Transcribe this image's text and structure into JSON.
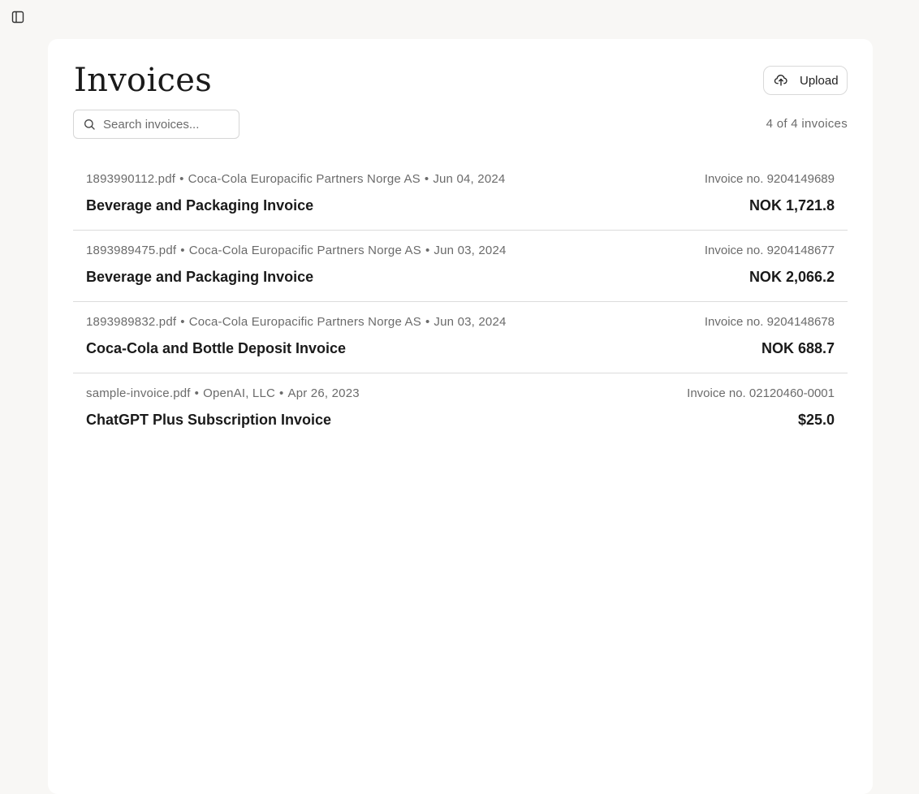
{
  "page": {
    "title": "Invoices",
    "upload_label": "Upload",
    "search_placeholder": "Search invoices...",
    "count_text": "4 of 4 invoices"
  },
  "invoices": [
    {
      "file": "1893990112.pdf",
      "vendor": "Coca-Cola Europacific Partners Norge AS",
      "date": "Jun 04, 2024",
      "invoice_no": "Invoice no. 9204149689",
      "title": "Beverage and Packaging Invoice",
      "amount": "NOK 1,721.8"
    },
    {
      "file": "1893989475.pdf",
      "vendor": "Coca-Cola Europacific Partners Norge AS",
      "date": "Jun 03, 2024",
      "invoice_no": "Invoice no. 9204148677",
      "title": "Beverage and Packaging Invoice",
      "amount": "NOK 2,066.2"
    },
    {
      "file": "1893989832.pdf",
      "vendor": "Coca-Cola Europacific Partners Norge AS",
      "date": "Jun 03, 2024",
      "invoice_no": "Invoice no. 9204148678",
      "title": "Coca-Cola and Bottle Deposit Invoice",
      "amount": "NOK 688.7"
    },
    {
      "file": "sample-invoice.pdf",
      "vendor": "OpenAI, LLC",
      "date": "Apr 26, 2023",
      "invoice_no": "Invoice no. 02120460-0001",
      "title": "ChatGPT Plus Subscription Invoice",
      "amount": "$25.0"
    }
  ],
  "icons": {
    "sidebar_toggle": "sidebar-toggle-icon",
    "upload": "cloud-upload-icon",
    "search": "search-icon"
  },
  "colors": {
    "background": "#f8f7f5",
    "card": "#ffffff",
    "muted_text": "#6b6b6b",
    "divider": "#dcdcdc"
  }
}
